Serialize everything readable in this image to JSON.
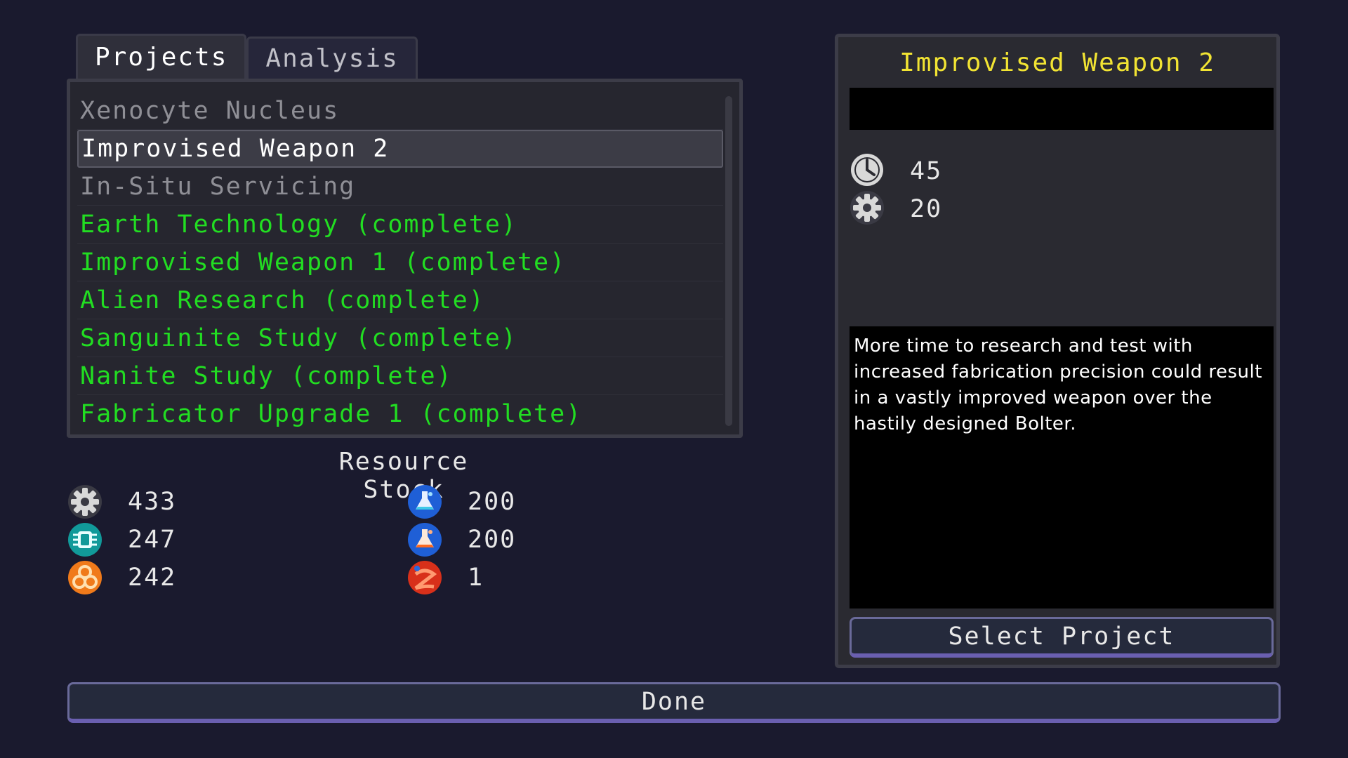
{
  "tabs": [
    {
      "label": "Projects",
      "active": true
    },
    {
      "label": "Analysis",
      "active": false
    }
  ],
  "projects": [
    {
      "label": "Xenocyte Nucleus",
      "state": "locked"
    },
    {
      "label": "Improvised Weapon 2",
      "state": "selected"
    },
    {
      "label": "In-Situ Servicing",
      "state": "available"
    },
    {
      "label": "Earth Technology (complete)",
      "state": "complete"
    },
    {
      "label": "Improvised Weapon 1 (complete)",
      "state": "complete"
    },
    {
      "label": "Alien Research (complete)",
      "state": "complete"
    },
    {
      "label": "Sanguinite Study (complete)",
      "state": "complete"
    },
    {
      "label": "Nanite Study (complete)",
      "state": "complete"
    },
    {
      "label": "Fabricator Upgrade 1 (complete)",
      "state": "complete"
    }
  ],
  "resource_stock": {
    "title": "Resource Stock",
    "items": [
      {
        "icon": "gear-icon",
        "value": "433"
      },
      {
        "icon": "blue-flask-icon",
        "value": "200"
      },
      {
        "icon": "chip-icon",
        "value": "247"
      },
      {
        "icon": "orange-flask-icon",
        "value": "200"
      },
      {
        "icon": "biohazard-icon",
        "value": "242"
      },
      {
        "icon": "red-orb-icon",
        "value": "1"
      }
    ]
  },
  "detail": {
    "title": "Improvised Weapon 2",
    "time_cost": "45",
    "time_icon": "clock-icon",
    "material_cost": "20",
    "material_icon": "gear-icon",
    "description": "More time to research and test with increased fabrication precision could result in a vastly improved weapon over the hastily designed Bolter.",
    "select_label": "Select Project"
  },
  "done_label": "Done",
  "colors": {
    "complete": "#22dd22",
    "title": "#f2e433",
    "background": "#1a1a2e"
  }
}
